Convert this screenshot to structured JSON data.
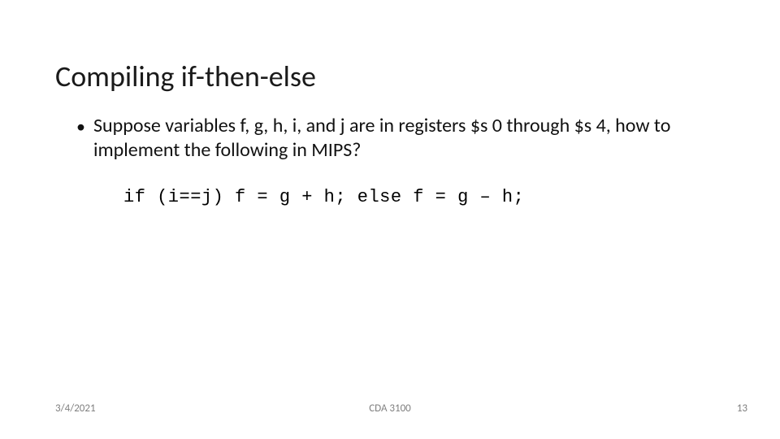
{
  "title": "Compiling if-then-else",
  "bullet": {
    "dot": "•",
    "text": "Suppose variables f, g, h, i, and j are in registers $s 0 through $s 4, how to implement the following in MIPS?"
  },
  "code": "if (i==j) f = g + h; else f = g – h;",
  "footer": {
    "date": "3/4/2021",
    "center": "CDA 3100",
    "page": "13"
  }
}
